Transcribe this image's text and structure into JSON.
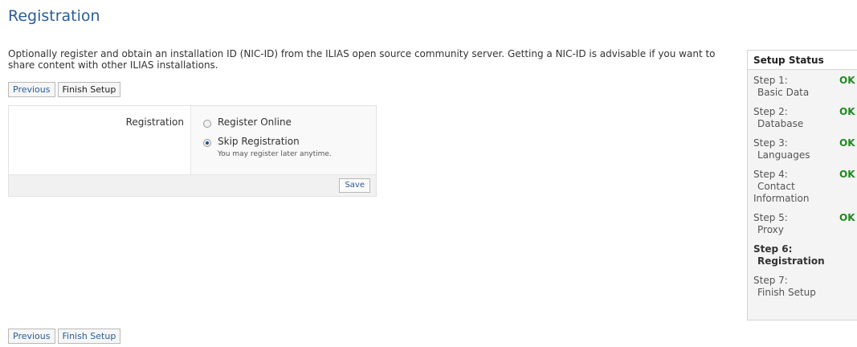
{
  "page": {
    "title": "Registration",
    "intro": "Optionally register and obtain an installation ID (NIC-ID) from the ILIAS open source community server. Getting a NIC-ID is advisable if you want to share content with other ILIAS installations."
  },
  "nav": {
    "previous": "Previous",
    "finish": "Finish Setup"
  },
  "form": {
    "label": "Registration",
    "options": [
      {
        "label": "Register Online",
        "selected": false
      },
      {
        "label": "Skip Registration",
        "hint": "You may register later anytime.",
        "selected": true
      }
    ],
    "save": "Save"
  },
  "status": {
    "title": "Setup Status",
    "steps": [
      {
        "line1": "Step 1:",
        "line2": "Basic Data",
        "ok": "OK"
      },
      {
        "line1": "Step 2:",
        "line2": "Database",
        "ok": "OK"
      },
      {
        "line1": "Step 3:",
        "line2": "Languages",
        "ok": "OK"
      },
      {
        "line1": "Step 4:",
        "line2": "Contact",
        "line3": "Information",
        "ok": "OK"
      },
      {
        "line1": "Step 5:",
        "line2": "Proxy",
        "ok": "OK"
      },
      {
        "line1": "Step 6:",
        "line2": "Registration",
        "current": true
      },
      {
        "line1": "Step 7:",
        "line2": "Finish Setup"
      }
    ]
  },
  "colors": {
    "link": "#2a5d96",
    "ok": "#1d8a1d"
  }
}
